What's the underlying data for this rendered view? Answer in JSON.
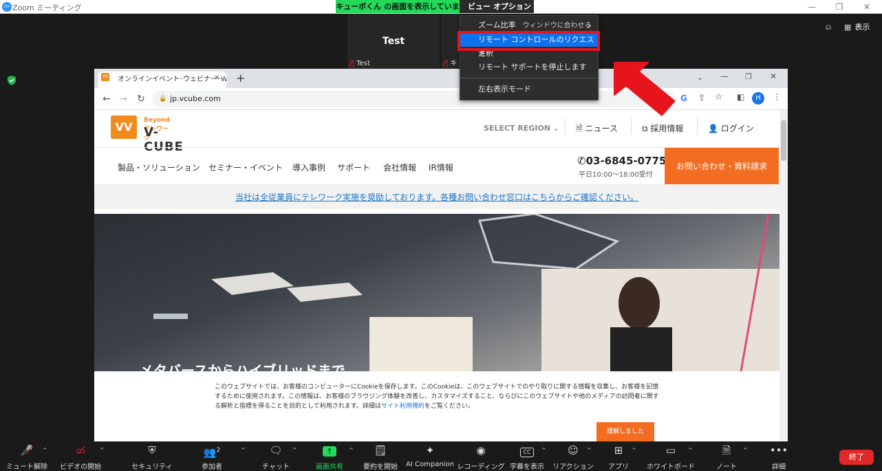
{
  "window": {
    "title": "Zoom ミーティング"
  },
  "share_bar": {
    "label": "キューボくん の画面を表示しています",
    "view_options": "ビュー オプション"
  },
  "participants": [
    {
      "name": "Test",
      "label": "Test"
    },
    {
      "label": "キ"
    }
  ],
  "top_right": {
    "view_label": "表示"
  },
  "menu": {
    "items": [
      "ズーム比率",
      "リモート コントロールのリクエスト",
      "注釈",
      "リモート サポートを停止します",
      "左右表示モード"
    ],
    "zoom_sub": "ウィンドウに合わせる"
  },
  "browser": {
    "tab_title": "オンラインイベント･ウェビナー･Web会議",
    "url": "jp.vcube.com",
    "profile_initial": "H"
  },
  "site": {
    "logo": {
      "beyond": "Beyond テレワーク",
      "name": "V-CUBE",
      "mark": "VV"
    },
    "header": {
      "region": "SELECT REGION",
      "news": "ニュース",
      "recruit": "採用情報",
      "login": "ログイン"
    },
    "nav": [
      "製品・ソリューション",
      "セミナー・イベント",
      "導入事例",
      "サポート",
      "会社情報",
      "IR情報"
    ],
    "phone": "03-6845-0775",
    "hours": "平日10:00〜18:00受付",
    "contact": "お問い合わせ・資料請求",
    "notice": "当社は全従業員にテレワーク実施を奨励しております。各種お問い合わせ窓口はこちらからご確認ください。",
    "hero_text": "メタバースからハイブリッドまで",
    "cookie": {
      "text_before": "このウェブサイトでは、お客様のコンピューターにCookieを保存します。このCookieは、このウェブサイトでのやり取りに関する情報を収集し、お客様を記憶するために使用されます。この情報は、お客様のブラウジング体験を改善し、カスタマイズすること、ならびにこのウェブサイトや他のメディアの訪問者に関する解析と指標を得ることを目的として利用されます。詳細は",
      "link": "サイト利用規約",
      "text_after": "をご覧ください。",
      "button": "理解しました"
    }
  },
  "toolbar": {
    "items": [
      "ミュート解除",
      "ビデオの開始",
      "セキュリティ",
      "参加者",
      "チャット",
      "画面共有",
      "要約を開始",
      "AI Companion",
      "レコーディング",
      "字幕を表示",
      "リアクション",
      "アプリ",
      "ホワイトボード",
      "ノート",
      "詳細"
    ],
    "participant_count": "2",
    "end": "終了",
    "accent": "#23d959"
  }
}
